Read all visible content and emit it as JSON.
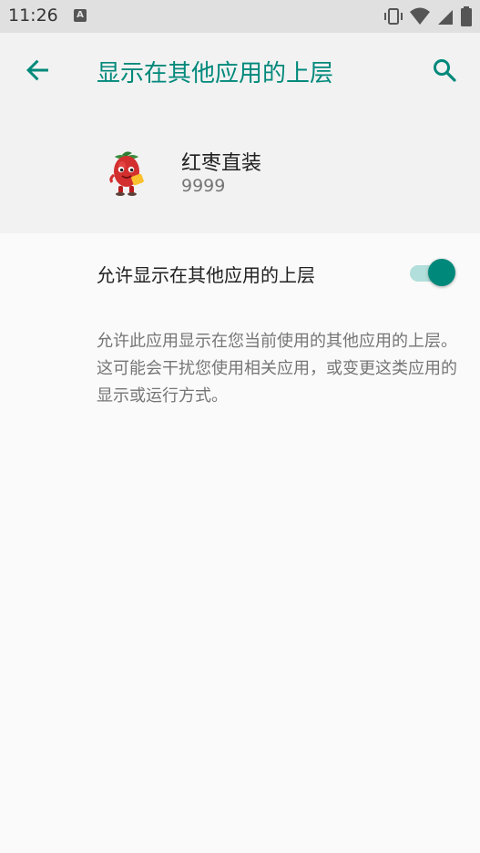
{
  "status_bar": {
    "time": "11:26",
    "notification_icon": "app-notification-icon",
    "icons": [
      "vibrate-icon",
      "wifi-icon",
      "cell-signal-icon",
      "battery-icon"
    ]
  },
  "header": {
    "title": "显示在其他应用的上层",
    "back_icon": "arrow-back-icon",
    "search_icon": "search-icon",
    "accent_color": "#00897b"
  },
  "app": {
    "name": "红枣直装",
    "version": "9999",
    "icon": "red-date-mascot-icon"
  },
  "permission": {
    "label": "允许显示在其他应用的上层",
    "enabled": true
  },
  "description": "允许此应用显示在您当前使用的其他应用的上层。这可能会干扰您使用相关应用，或变更这类应用的显示或运行方式。"
}
